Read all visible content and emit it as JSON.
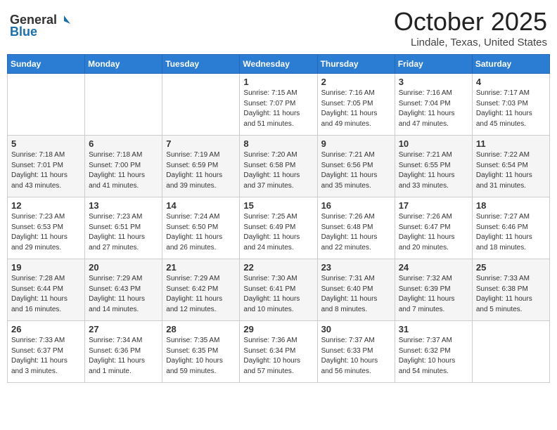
{
  "header": {
    "logo_general": "General",
    "logo_blue": "Blue",
    "month": "October 2025",
    "location": "Lindale, Texas, United States"
  },
  "weekdays": [
    "Sunday",
    "Monday",
    "Tuesday",
    "Wednesday",
    "Thursday",
    "Friday",
    "Saturday"
  ],
  "weeks": [
    [
      {
        "day": "",
        "info": ""
      },
      {
        "day": "",
        "info": ""
      },
      {
        "day": "",
        "info": ""
      },
      {
        "day": "1",
        "info": "Sunrise: 7:15 AM\nSunset: 7:07 PM\nDaylight: 11 hours\nand 51 minutes."
      },
      {
        "day": "2",
        "info": "Sunrise: 7:16 AM\nSunset: 7:05 PM\nDaylight: 11 hours\nand 49 minutes."
      },
      {
        "day": "3",
        "info": "Sunrise: 7:16 AM\nSunset: 7:04 PM\nDaylight: 11 hours\nand 47 minutes."
      },
      {
        "day": "4",
        "info": "Sunrise: 7:17 AM\nSunset: 7:03 PM\nDaylight: 11 hours\nand 45 minutes."
      }
    ],
    [
      {
        "day": "5",
        "info": "Sunrise: 7:18 AM\nSunset: 7:01 PM\nDaylight: 11 hours\nand 43 minutes."
      },
      {
        "day": "6",
        "info": "Sunrise: 7:18 AM\nSunset: 7:00 PM\nDaylight: 11 hours\nand 41 minutes."
      },
      {
        "day": "7",
        "info": "Sunrise: 7:19 AM\nSunset: 6:59 PM\nDaylight: 11 hours\nand 39 minutes."
      },
      {
        "day": "8",
        "info": "Sunrise: 7:20 AM\nSunset: 6:58 PM\nDaylight: 11 hours\nand 37 minutes."
      },
      {
        "day": "9",
        "info": "Sunrise: 7:21 AM\nSunset: 6:56 PM\nDaylight: 11 hours\nand 35 minutes."
      },
      {
        "day": "10",
        "info": "Sunrise: 7:21 AM\nSunset: 6:55 PM\nDaylight: 11 hours\nand 33 minutes."
      },
      {
        "day": "11",
        "info": "Sunrise: 7:22 AM\nSunset: 6:54 PM\nDaylight: 11 hours\nand 31 minutes."
      }
    ],
    [
      {
        "day": "12",
        "info": "Sunrise: 7:23 AM\nSunset: 6:53 PM\nDaylight: 11 hours\nand 29 minutes."
      },
      {
        "day": "13",
        "info": "Sunrise: 7:23 AM\nSunset: 6:51 PM\nDaylight: 11 hours\nand 27 minutes."
      },
      {
        "day": "14",
        "info": "Sunrise: 7:24 AM\nSunset: 6:50 PM\nDaylight: 11 hours\nand 26 minutes."
      },
      {
        "day": "15",
        "info": "Sunrise: 7:25 AM\nSunset: 6:49 PM\nDaylight: 11 hours\nand 24 minutes."
      },
      {
        "day": "16",
        "info": "Sunrise: 7:26 AM\nSunset: 6:48 PM\nDaylight: 11 hours\nand 22 minutes."
      },
      {
        "day": "17",
        "info": "Sunrise: 7:26 AM\nSunset: 6:47 PM\nDaylight: 11 hours\nand 20 minutes."
      },
      {
        "day": "18",
        "info": "Sunrise: 7:27 AM\nSunset: 6:46 PM\nDaylight: 11 hours\nand 18 minutes."
      }
    ],
    [
      {
        "day": "19",
        "info": "Sunrise: 7:28 AM\nSunset: 6:44 PM\nDaylight: 11 hours\nand 16 minutes."
      },
      {
        "day": "20",
        "info": "Sunrise: 7:29 AM\nSunset: 6:43 PM\nDaylight: 11 hours\nand 14 minutes."
      },
      {
        "day": "21",
        "info": "Sunrise: 7:29 AM\nSunset: 6:42 PM\nDaylight: 11 hours\nand 12 minutes."
      },
      {
        "day": "22",
        "info": "Sunrise: 7:30 AM\nSunset: 6:41 PM\nDaylight: 11 hours\nand 10 minutes."
      },
      {
        "day": "23",
        "info": "Sunrise: 7:31 AM\nSunset: 6:40 PM\nDaylight: 11 hours\nand 8 minutes."
      },
      {
        "day": "24",
        "info": "Sunrise: 7:32 AM\nSunset: 6:39 PM\nDaylight: 11 hours\nand 7 minutes."
      },
      {
        "day": "25",
        "info": "Sunrise: 7:33 AM\nSunset: 6:38 PM\nDaylight: 11 hours\nand 5 minutes."
      }
    ],
    [
      {
        "day": "26",
        "info": "Sunrise: 7:33 AM\nSunset: 6:37 PM\nDaylight: 11 hours\nand 3 minutes."
      },
      {
        "day": "27",
        "info": "Sunrise: 7:34 AM\nSunset: 6:36 PM\nDaylight: 11 hours\nand 1 minute."
      },
      {
        "day": "28",
        "info": "Sunrise: 7:35 AM\nSunset: 6:35 PM\nDaylight: 10 hours\nand 59 minutes."
      },
      {
        "day": "29",
        "info": "Sunrise: 7:36 AM\nSunset: 6:34 PM\nDaylight: 10 hours\nand 57 minutes."
      },
      {
        "day": "30",
        "info": "Sunrise: 7:37 AM\nSunset: 6:33 PM\nDaylight: 10 hours\nand 56 minutes."
      },
      {
        "day": "31",
        "info": "Sunrise: 7:37 AM\nSunset: 6:32 PM\nDaylight: 10 hours\nand 54 minutes."
      },
      {
        "day": "",
        "info": ""
      }
    ]
  ]
}
